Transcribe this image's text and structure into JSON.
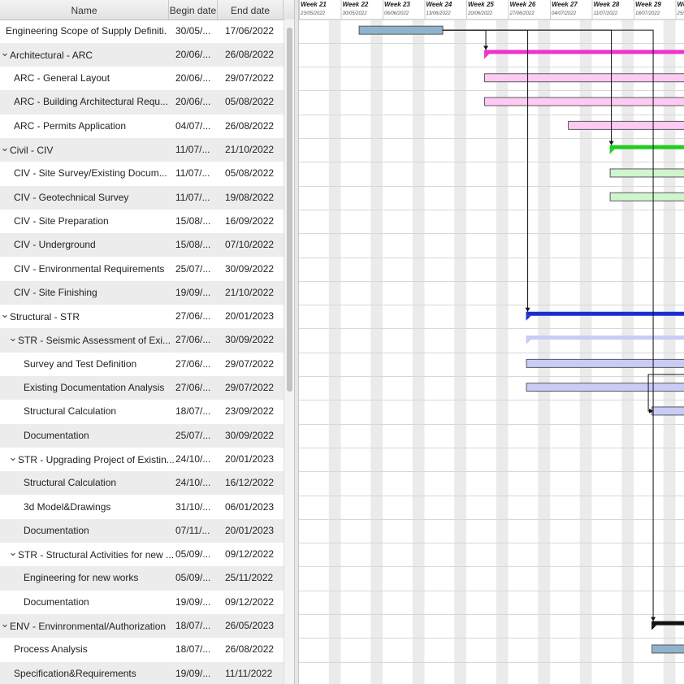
{
  "columns": {
    "name": "Name",
    "begin": "Begin date",
    "end": "End date"
  },
  "tasks": [
    {
      "name": "Engineering Scope of Supply Definiti...",
      "begin": "30/05/...",
      "end": "17/06/2022",
      "level": 0,
      "expander": false,
      "bar": {
        "start": 10,
        "end": 24,
        "kind": "task",
        "color": "#8fb3cc"
      }
    },
    {
      "name": "Architectural - ARC",
      "begin": "20/06/...",
      "end": "26/08/2022",
      "level": 0,
      "expander": true,
      "bar": {
        "start": 31,
        "end": 98,
        "kind": "summary",
        "color": "#ee33cc"
      }
    },
    {
      "name": "ARC - General Layout",
      "begin": "20/06/...",
      "end": "29/07/2022",
      "level": 1,
      "expander": false,
      "bar": {
        "start": 31,
        "end": 70,
        "kind": "task",
        "color": "#fccaf2"
      }
    },
    {
      "name": "ARC - Building Architectural Requ...",
      "begin": "20/06/...",
      "end": "05/08/2022",
      "level": 1,
      "expander": false,
      "bar": {
        "start": 31,
        "end": 77,
        "kind": "task",
        "color": "#fccaf2"
      }
    },
    {
      "name": "ARC - Permits Application",
      "begin": "04/07/...",
      "end": "26/08/2022",
      "level": 1,
      "expander": false,
      "bar": {
        "start": 45,
        "end": 98,
        "kind": "task",
        "color": "#fccaf2"
      }
    },
    {
      "name": "Civil - CIV",
      "begin": "11/07/...",
      "end": "21/10/2022",
      "level": 0,
      "expander": true,
      "bar": {
        "start": 52,
        "end": 154,
        "kind": "summary",
        "color": "#22cc22"
      }
    },
    {
      "name": "CIV - Site Survey/Existing Docum...",
      "begin": "11/07/...",
      "end": "05/08/2022",
      "level": 1,
      "expander": false,
      "bar": {
        "start": 52,
        "end": 77,
        "kind": "task",
        "color": "#cff5cf"
      }
    },
    {
      "name": "CIV - Geotechnical Survey",
      "begin": "11/07/...",
      "end": "19/08/2022",
      "level": 1,
      "expander": false,
      "bar": {
        "start": 52,
        "end": 91,
        "kind": "task",
        "color": "#cff5cf"
      }
    },
    {
      "name": "CIV - Site Preparation",
      "begin": "15/08/...",
      "end": "16/09/2022",
      "level": 1,
      "expander": false,
      "bar": {
        "start": 87,
        "end": 119,
        "kind": "task",
        "color": "#cff5cf"
      }
    },
    {
      "name": "CIV - Underground",
      "begin": "15/08/...",
      "end": "07/10/2022",
      "level": 1,
      "expander": false,
      "bar": {
        "start": 87,
        "end": 140,
        "kind": "task",
        "color": "#cff5cf"
      }
    },
    {
      "name": "CIV - Environmental Requirements",
      "begin": "25/07/...",
      "end": "30/09/2022",
      "level": 1,
      "expander": false,
      "bar": {
        "start": 66,
        "end": 133,
        "kind": "task",
        "color": "#cff5cf"
      }
    },
    {
      "name": "CIV - Site Finishing",
      "begin": "19/09/...",
      "end": "21/10/2022",
      "level": 1,
      "expander": false,
      "bar": {
        "start": 122,
        "end": 154,
        "kind": "task",
        "color": "#cff5cf"
      }
    },
    {
      "name": "Structural - STR",
      "begin": "27/06/...",
      "end": "20/01/2023",
      "level": 0,
      "expander": true,
      "bar": {
        "start": 38,
        "end": 245,
        "kind": "summary",
        "color": "#1c2ed0"
      }
    },
    {
      "name": "STR - Seismic Assessment of Exi...",
      "begin": "27/06/...",
      "end": "30/09/2022",
      "level": 1,
      "expander": true,
      "bar": {
        "start": 38,
        "end": 133,
        "kind": "summary",
        "color": "#c8ccf6"
      }
    },
    {
      "name": "Survey and Test Definition",
      "begin": "27/06/...",
      "end": "29/07/2022",
      "level": 2,
      "expander": false,
      "bar": {
        "start": 38,
        "end": 70,
        "kind": "task",
        "color": "#c8ccf6"
      }
    },
    {
      "name": "Existing Documentation Analysis",
      "begin": "27/06/...",
      "end": "29/07/2022",
      "level": 2,
      "expander": false,
      "bar": {
        "start": 38,
        "end": 70,
        "kind": "task",
        "color": "#c8ccf6"
      }
    },
    {
      "name": "Structural Calculation",
      "begin": "18/07/...",
      "end": "23/09/2022",
      "level": 2,
      "expander": false,
      "bar": {
        "start": 59,
        "end": 126,
        "kind": "task",
        "color": "#c8ccf6"
      }
    },
    {
      "name": "Documentation",
      "begin": "25/07/...",
      "end": "30/09/2022",
      "level": 2,
      "expander": false,
      "bar": {
        "start": 66,
        "end": 133,
        "kind": "task",
        "color": "#c8ccf6"
      }
    },
    {
      "name": "STR - Upgrading Project of Existin...",
      "begin": "24/10/...",
      "end": "20/01/2023",
      "level": 1,
      "expander": true,
      "bar": {
        "start": 157,
        "end": 245,
        "kind": "summary",
        "color": "#c8ccf6"
      }
    },
    {
      "name": "Structural Calculation",
      "begin": "24/10/...",
      "end": "16/12/2022",
      "level": 2,
      "expander": false,
      "bar": {
        "start": 157,
        "end": 210,
        "kind": "task",
        "color": "#c8ccf6"
      }
    },
    {
      "name": "3d Model&Drawings",
      "begin": "31/10/...",
      "end": "06/01/2023",
      "level": 2,
      "expander": false,
      "bar": {
        "start": 164,
        "end": 231,
        "kind": "task",
        "color": "#c8ccf6"
      }
    },
    {
      "name": "Documentation",
      "begin": "07/11/...",
      "end": "20/01/2023",
      "level": 2,
      "expander": false,
      "bar": {
        "start": 171,
        "end": 245,
        "kind": "task",
        "color": "#c8ccf6"
      }
    },
    {
      "name": "STR - Structural Activities for new ...",
      "begin": "05/09/...",
      "end": "09/12/2022",
      "level": 1,
      "expander": true,
      "bar": {
        "start": 108,
        "end": 203,
        "kind": "summary",
        "color": "#c8ccf6"
      }
    },
    {
      "name": "Engineering for new works",
      "begin": "05/09/...",
      "end": "25/11/2022",
      "level": 2,
      "expander": false,
      "bar": {
        "start": 108,
        "end": 189,
        "kind": "task",
        "color": "#c8ccf6"
      }
    },
    {
      "name": "Documentation",
      "begin": "19/09/...",
      "end": "09/12/2022",
      "level": 2,
      "expander": false,
      "bar": {
        "start": 122,
        "end": 203,
        "kind": "task",
        "color": "#c8ccf6"
      }
    },
    {
      "name": "ENV - Envinronmental/Authorization",
      "begin": "18/07/...",
      "end": "26/05/2023",
      "level": 0,
      "expander": true,
      "bar": {
        "start": 59,
        "end": 371,
        "kind": "summary",
        "color": "#111111"
      }
    },
    {
      "name": "Process Analysis",
      "begin": "18/07/...",
      "end": "26/08/2022",
      "level": 1,
      "expander": false,
      "bar": {
        "start": 59,
        "end": 98,
        "kind": "task",
        "color": "#8fb3cc"
      }
    },
    {
      "name": "Specification&Requirements",
      "begin": "19/09/...",
      "end": "11/11/2022",
      "level": 1,
      "expander": false,
      "bar": {
        "start": 122,
        "end": 175,
        "kind": "task",
        "color": "#c8ccf6"
      }
    }
  ],
  "timeline": {
    "weeks": [
      {
        "label": "Week 21",
        "date": "23/05/2022"
      },
      {
        "label": "Week 22",
        "date": "30/05/2022"
      },
      {
        "label": "Week 23",
        "date": "06/06/2022"
      },
      {
        "label": "Week 24",
        "date": "13/06/2022"
      },
      {
        "label": "Week 25",
        "date": "20/06/2022"
      },
      {
        "label": "Week 26",
        "date": "27/06/2022"
      },
      {
        "label": "Week 27",
        "date": "04/07/2022"
      },
      {
        "label": "Week 28",
        "date": "11/07/2022"
      },
      {
        "label": "Week 29",
        "date": "18/07/2022"
      },
      {
        "label": "We",
        "date": "25/"
      }
    ],
    "dependencies": [
      {
        "from": 0,
        "to": 1
      },
      {
        "from": 0,
        "to": 12
      },
      {
        "from": 0,
        "to": 5
      },
      {
        "from": 0,
        "to": 25
      },
      {
        "from": 14,
        "to": 16
      },
      {
        "from": 15,
        "to": 17
      }
    ]
  }
}
